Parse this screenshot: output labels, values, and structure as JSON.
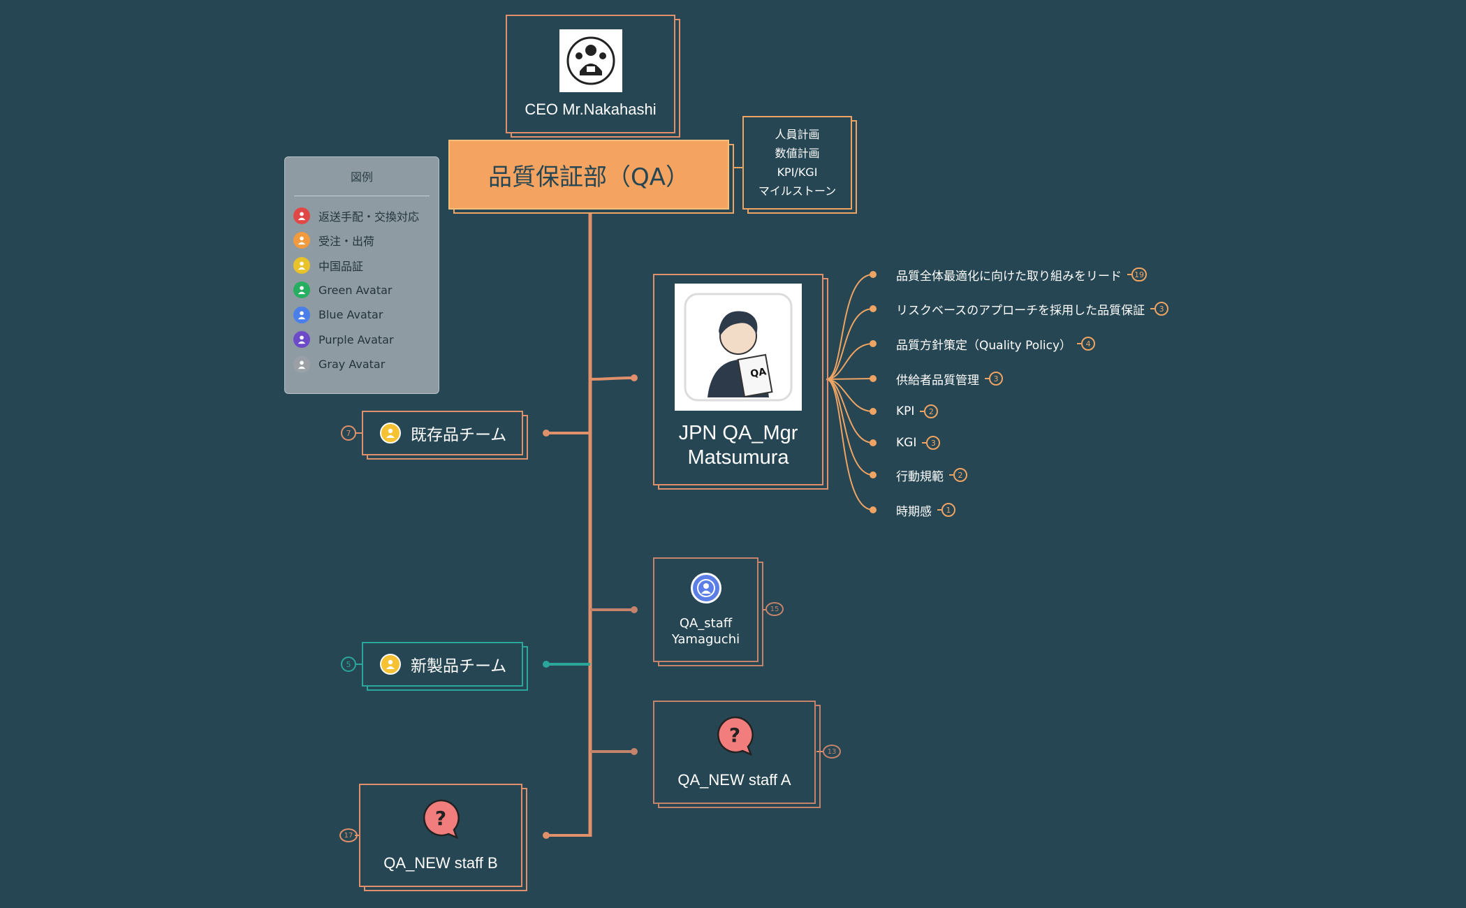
{
  "colors": {
    "background": "#264653",
    "connector": "#e0906a",
    "teal": "#2aa79a",
    "qa_fill": "#f4a460",
    "legend_panel": "#8e9ba3"
  },
  "ceo": {
    "label": "CEO Mr.Nakahashi",
    "icon": "ceo-portrait-icon"
  },
  "department": {
    "label": "品質保証部（QA）"
  },
  "plan_note": {
    "lines": [
      "人員計画",
      "数値計画",
      "KPI/KGI",
      "マイルストーン"
    ]
  },
  "legend": {
    "title": "図例",
    "items": [
      {
        "label": "返送手配・交換対応",
        "color": "#e04848"
      },
      {
        "label": "受注・出荷",
        "color": "#f19a3e"
      },
      {
        "label": "中国品証",
        "color": "#e8c22a"
      },
      {
        "label": "Green Avatar",
        "color": "#27ae60"
      },
      {
        "label": "Blue Avatar",
        "color": "#4a7ee8"
      },
      {
        "label": "Purple Avatar",
        "color": "#6c4bc9"
      },
      {
        "label": "Gray Avatar",
        "color": "#9aa0a6"
      }
    ]
  },
  "manager": {
    "label_line1": "JPN QA_Mgr",
    "label_line2": "Matsumura",
    "icon": "qa-manager-portrait-icon",
    "tasks": [
      {
        "label": "品質全体最適化に向けた取り組みをリード",
        "count": "19"
      },
      {
        "label": "リスクベースのアプローチを採用した品質保証",
        "count": "3"
      },
      {
        "label": "品質方針策定（Quality Policy）",
        "count": "4"
      },
      {
        "label": "供給者品質管理",
        "count": "3"
      },
      {
        "label": "KPI",
        "count": "2"
      },
      {
        "label": "KGI",
        "count": "3"
      },
      {
        "label": "行動規範",
        "count": "2"
      },
      {
        "label": "時期感",
        "count": "1"
      }
    ]
  },
  "existing_team": {
    "label": "既存品チーム",
    "count": "7"
  },
  "new_team": {
    "label": "新製品チーム",
    "count": "5"
  },
  "staff_yamaguchi": {
    "line1": "QA_staff",
    "line2": "Yamaguchi",
    "count": "15"
  },
  "staff_new_a": {
    "label": "QA_NEW staff A",
    "count": "13"
  },
  "staff_new_b": {
    "label": "QA_NEW staff B",
    "count": "17"
  }
}
